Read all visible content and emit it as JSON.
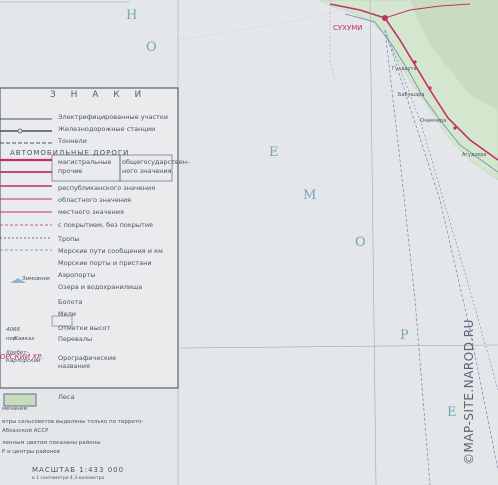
{
  "legend": {
    "title": "З Н А К И",
    "items_top": [
      "Электрифицированные участки",
      "Железнодорожные станции",
      "Тоннели"
    ],
    "roads_header": "АВТОМОБИЛЬНЫЕ ДОРОГИ",
    "items_roads": [
      "магистральные\nпрочие",
      "общегосударствен-\nного значения",
      "республиканского значения",
      "областного значения",
      "местного значения",
      "с покрытием, без покрытия"
    ],
    "items_other": [
      "Тропы",
      "Морские пути сообщения и км",
      "Морские порты и пристани",
      "Аэропорты",
      "Озера и водохранилища",
      "Болота",
      "Мели",
      "Отметки высот",
      "Перевалы",
      "Орографические\nназвания",
      "Леса"
    ],
    "left_labels": [
      "Зимовник",
      "4066",
      "пер.",
      "Кавказ",
      "Хребет",
      "Карлорский"
    ],
    "region_label": "ОРСКИЙ ХР.",
    "notes_label": "мечания:",
    "notes": [
      "етры сельсоветов выделены только по террито-",
      "Абхазской АССР",
      "ленным цветом показаны районы",
      "Р и центры районов"
    ]
  },
  "scale": {
    "label": "МАСШТАБ  1:433 000",
    "sub": "в 1 сантиметре 4,3 километра"
  },
  "sea_letters": [
    "Н",
    "О",
    "Е",
    "М",
    "О",
    "Р",
    "Е"
  ],
  "city": "СУХУМИ",
  "place_names": [
    "Гуадаута",
    "Бабушара",
    "Очамчира",
    "Агудзера"
  ],
  "watermark": "©MAP-SITE.NAROD.RU",
  "colors": {
    "sea": "#e4e7ea",
    "land": "#d8e8d0",
    "road_red": "#c0306a",
    "text": "#4e5360",
    "legend_box_bg": "#e9ebed"
  }
}
